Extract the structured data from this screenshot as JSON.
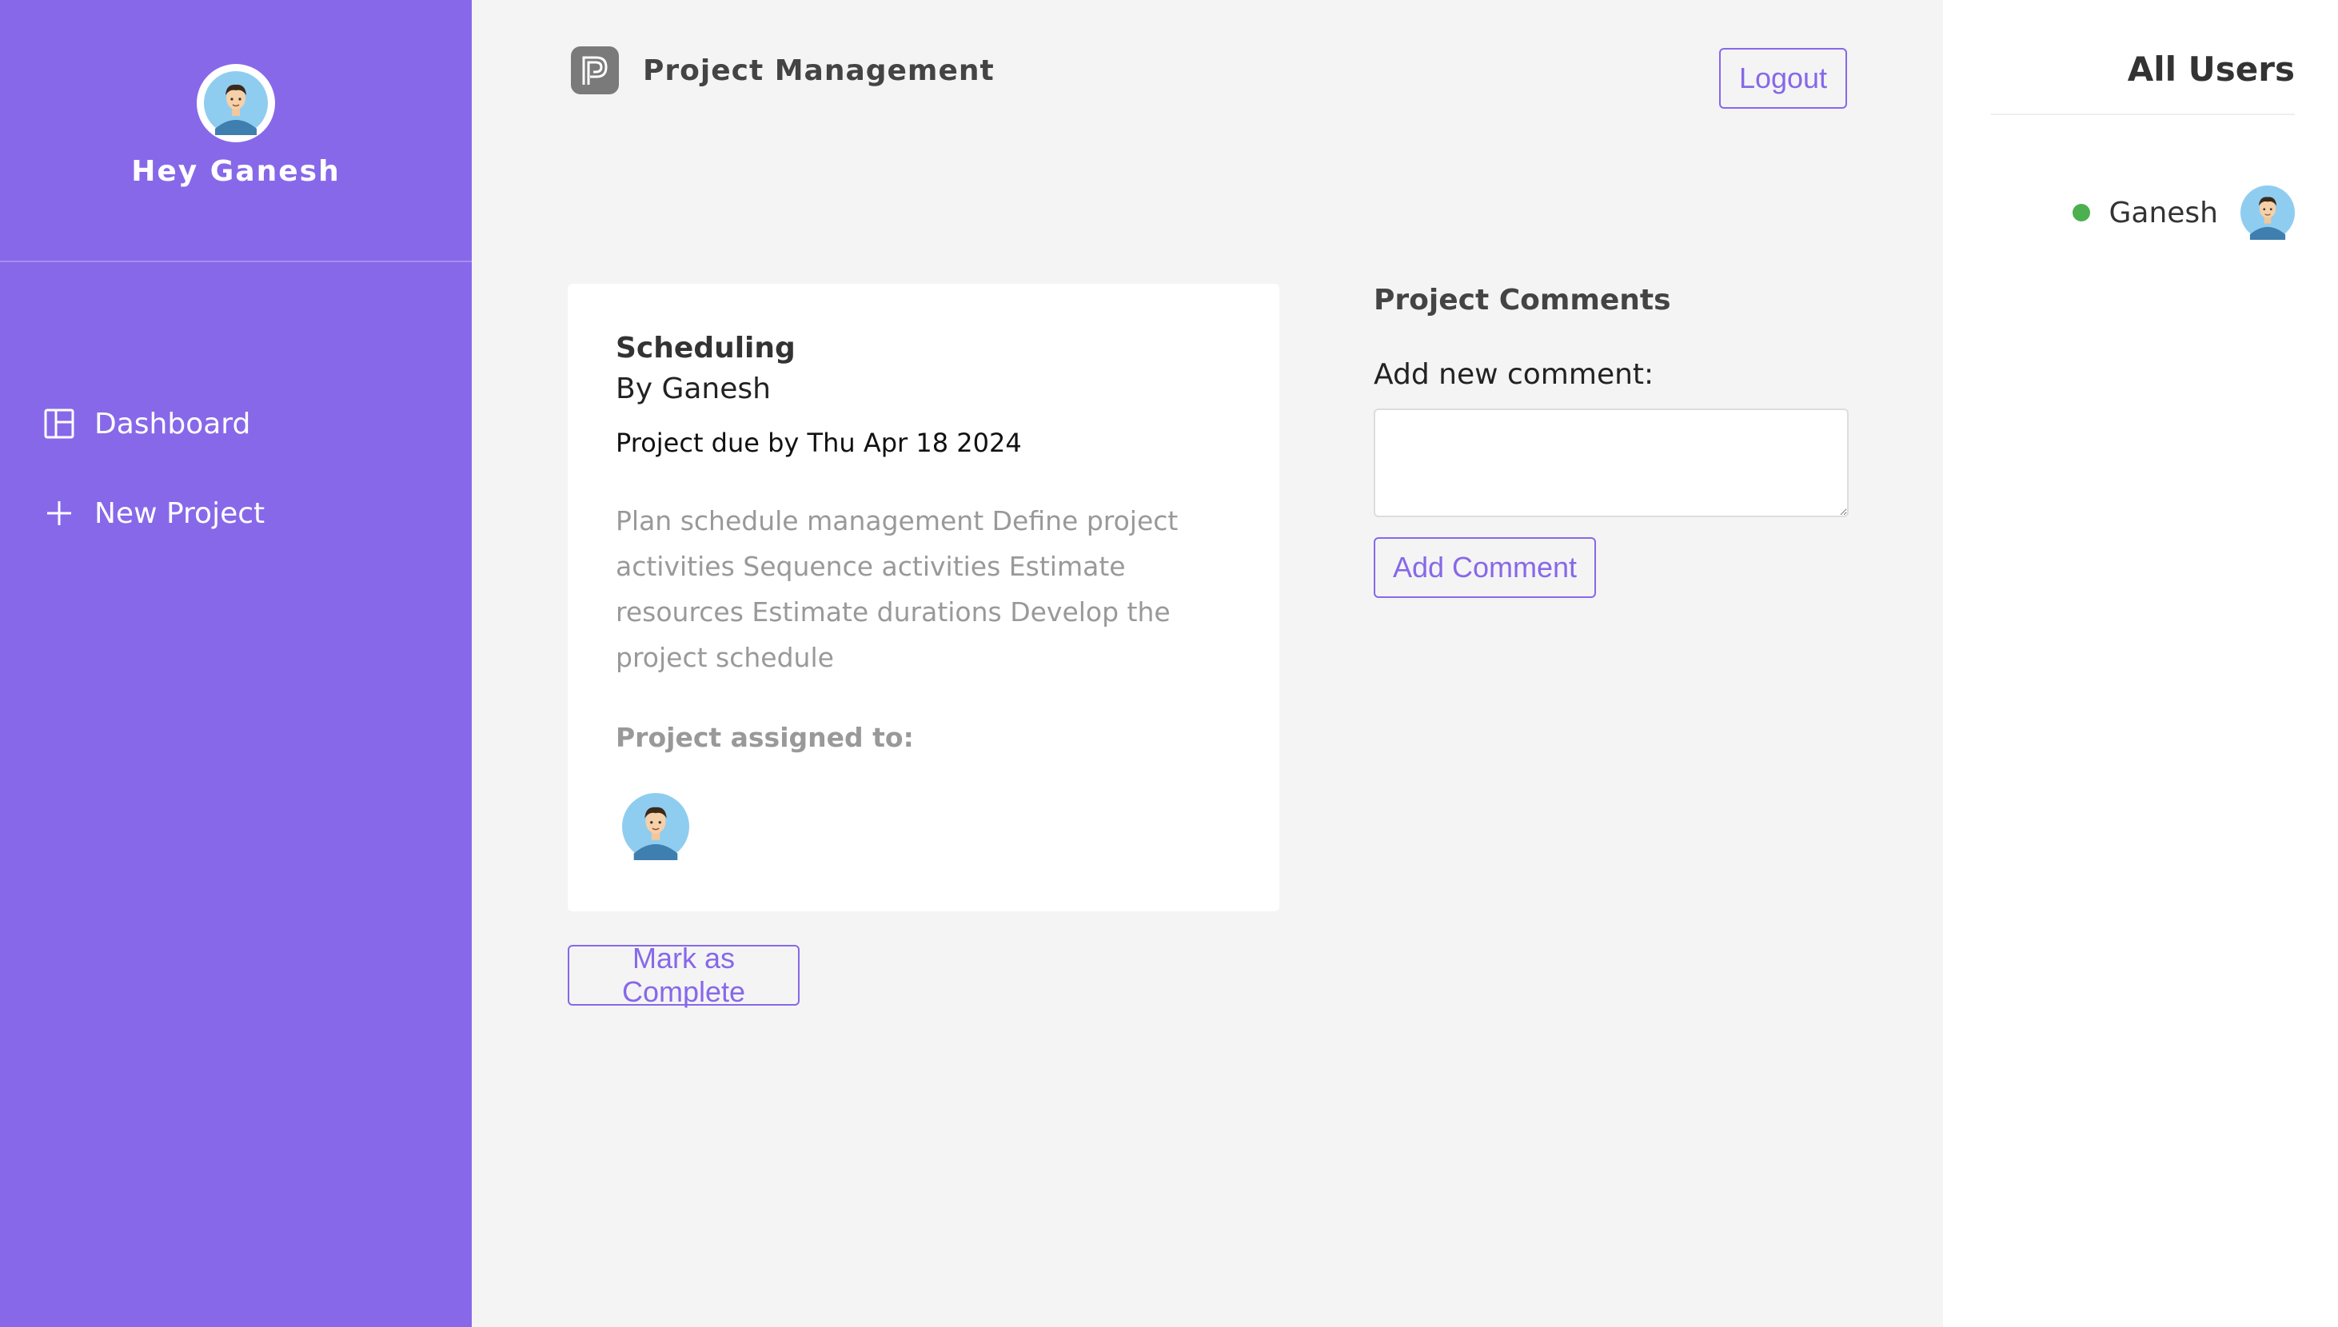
{
  "sidebar": {
    "greeting": "Hey Ganesh",
    "nav": [
      {
        "label": "Dashboard",
        "icon": "dashboard-icon"
      },
      {
        "label": "New Project",
        "icon": "plus-icon"
      }
    ],
    "accent_color": "#8768e9"
  },
  "header": {
    "app_title": "Project Management",
    "logout_label": "Logout"
  },
  "project": {
    "title": "Scheduling",
    "author": "By Ganesh",
    "due": "Project due by Thu Apr 18 2024",
    "description": "Plan schedule management Define project activities Sequence activities Estimate resources Estimate durations Develop the project schedule",
    "assigned_label": "Project assigned to:",
    "complete_label": "Mark as Complete"
  },
  "comments": {
    "title": "Project Comments",
    "new_label": "Add new comment:",
    "textarea_value": "",
    "add_label": "Add Comment"
  },
  "users": {
    "title": "All Users",
    "list": [
      {
        "name": "Ganesh",
        "status": "online",
        "status_color": "#4caf50"
      }
    ]
  }
}
